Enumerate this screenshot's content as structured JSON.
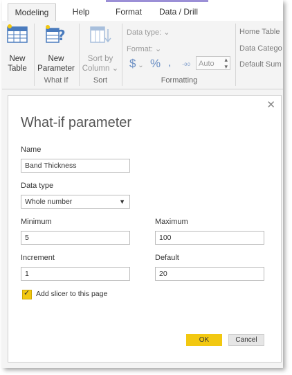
{
  "tabs": [
    {
      "label": "Modeling"
    },
    {
      "label": "Help"
    },
    {
      "label": "Format"
    },
    {
      "label": "Data / Drill"
    }
  ],
  "ribbon": {
    "new_table_line1": "New",
    "new_table_line2": "Table",
    "new_param_line1": "New",
    "new_param_line2": "Parameter",
    "whatif_group": "What If",
    "sort_line1": "Sort by",
    "sort_line2": "Column",
    "sort_group": "Sort",
    "data_type": "Data type:",
    "format": "Format:",
    "currency": "$",
    "percent": "%",
    "comma": ",",
    "auto": "Auto",
    "formatting_group": "Formatting",
    "home_table": "Home Table",
    "data_category": "Data Catego",
    "default_summ": "Default Sum"
  },
  "dialog": {
    "title": "What-if parameter",
    "name_label": "Name",
    "name_value": "Band Thickness",
    "datatype_label": "Data type",
    "datatype_value": "Whole number",
    "min_label": "Minimum",
    "min_value": "5",
    "max_label": "Maximum",
    "max_value": "100",
    "inc_label": "Increment",
    "inc_value": "1",
    "default_label": "Default",
    "default_value": "20",
    "slicer_label": "Add slicer to this page",
    "ok": "OK",
    "cancel": "Cancel"
  },
  "colors": {
    "accent_yellow": "#f2c811",
    "tab_accent": "#9b8fd6"
  }
}
